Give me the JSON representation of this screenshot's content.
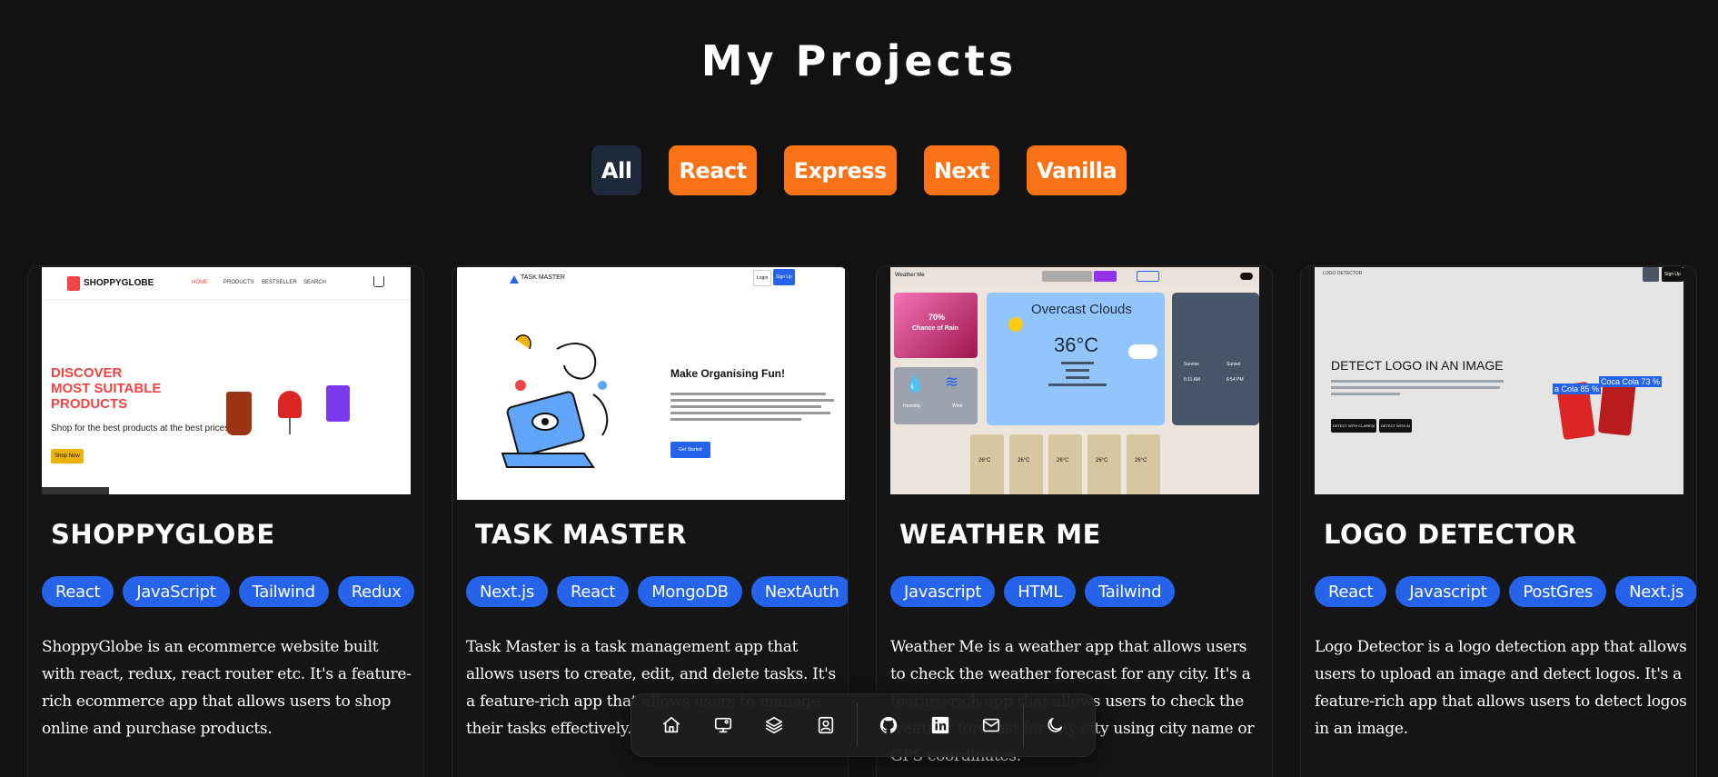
{
  "page": {
    "title": "My Projects"
  },
  "filters": [
    "All",
    "React",
    "Express",
    "Next",
    "Vanilla"
  ],
  "projects": [
    {
      "title": "SHOPPYGLOBE",
      "tags": [
        "React",
        "JavaScript",
        "Tailwind",
        "Redux"
      ],
      "description": "ShoppyGlobe is an ecommerce website built with react, redux, react router etc. It's a feature-rich ecommerce app that allows users to shop online and purchase products.",
      "thumb": {
        "brand": "SHOPPYGLOBE",
        "nav": [
          "HOME",
          "PRODUCTS",
          "BESTSELLER",
          "SEARCH"
        ],
        "headline": [
          "DISCOVER",
          "MOST SUITABLE",
          "PRODUCTS"
        ],
        "sub": "Shop for the best products at the best prices.",
        "cta": "Shop Now"
      }
    },
    {
      "title": "TASK MASTER",
      "tags": [
        "Next.js",
        "React",
        "MongoDB",
        "NextAuth"
      ],
      "description": "Task Master is a task management app that allows users to create, edit, and delete tasks. It's a feature-rich app that allows users to manage their tasks effectively.",
      "thumb": {
        "brand": "TASK MASTER",
        "login": "Login",
        "signup": "Sign Up",
        "headline": "Make Organising Fun!",
        "cta": "Get Started"
      }
    },
    {
      "title": "WEATHER ME",
      "tags": [
        "Javascript",
        "HTML",
        "Tailwind"
      ],
      "description": "Weather Me is a weather app that allows users to check the weather forecast for any city. It's a feature-rich app that allows users to check the weather forecast for any city using city name or GPS coordinates.",
      "thumb": {
        "brand": "Weather Me",
        "condition": "Overcast Clouds",
        "temp": "36°C",
        "chance": "70%",
        "chance_label": "Chance of Rain",
        "humidity_label": "Humidity",
        "wind_label": "Wind",
        "sunrise_label": "Sunrise",
        "sunset_label": "Sunset",
        "sunrise": "6:11 AM",
        "sunset": "6:54 PM",
        "forecast_temp": "26°C"
      }
    },
    {
      "title": "LOGO DETECTOR",
      "tags": [
        "React",
        "Javascript",
        "PostGres",
        "Next.js"
      ],
      "description": "Logo Detector is a logo detection app that allows users to upload an image and detect logos. It's a feature-rich app that allows users to detect logos in an image.",
      "thumb": {
        "brand": "LOGO DETECTOR",
        "signup": "Sign Up",
        "headline": "DETECT LOGO IN AN IMAGE",
        "btn1": "DETECT WITH CLARIFAI",
        "btn2": "DETECT WITH AI",
        "label1": "a Cola 85 %",
        "label2": "Coca Cola 73 %"
      }
    }
  ],
  "dock": {
    "icons": [
      "home-icon",
      "monitor-icon",
      "layers-icon",
      "contact-icon",
      "github-icon",
      "linkedin-icon",
      "mail-icon",
      "moon-icon"
    ]
  },
  "colors": {
    "background": "#121212",
    "accent": "#f97316",
    "tag": "#2563eb",
    "active_filter": "#1e293b"
  }
}
